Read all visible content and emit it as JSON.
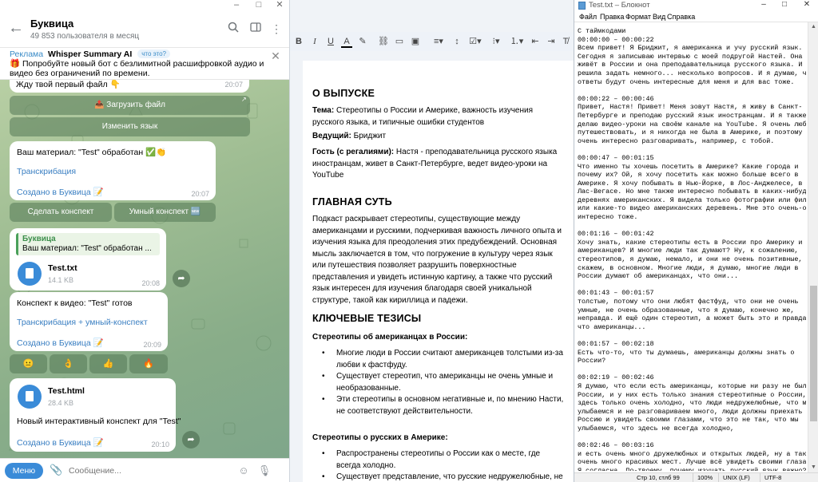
{
  "telegram": {
    "window_controls": [
      "–",
      "□",
      "✕"
    ],
    "header": {
      "title": "Буквица",
      "subtitle": "49 853 пользователя в месяц"
    },
    "ad": {
      "label": "Реклама",
      "title": "Whisper Summary AI",
      "badge": "что это?",
      "text": "🎁 Попробуйте новый бот с безлимитной расшифровкой аудио и видео без ограничений по времени."
    },
    "partial_message": {
      "text": "Жду твой первый файл 👇",
      "time": "20:07"
    },
    "buttons": {
      "upload": "📤 Загрузить файл",
      "change_lang": "Изменить язык"
    },
    "msg_processed": {
      "text": "Ваш материал: \"Test\" обработан ✅👏",
      "link1": "Транскрибация",
      "link2": "Создано в Буквица 📝",
      "time": "20:07"
    },
    "buttons2": {
      "summary": "Сделать конспект",
      "smart_summary": "Умный конспект 🆕"
    },
    "msg_file1": {
      "reply_author": "Буквица",
      "reply_text": "Ваш материал: \"Test\" обработан ...",
      "file_name": "Test.txt",
      "file_size": "14.1 KB",
      "time": "20:08"
    },
    "msg_summary_ready": {
      "text": "Конспект к видео: \"Test\" готов",
      "link1": "Транскрибация + умный-конспект",
      "link2": "Создано в Буквица 📝",
      "time": "20:09"
    },
    "reactions": [
      "😐",
      "👌",
      "👍",
      "🔥"
    ],
    "msg_file2": {
      "file_name": "Test.html",
      "file_size": "28.4 KB",
      "text": "Новый интерактивный конспект для \"Test\"",
      "link": "Создано в Буквица 📝",
      "time": "20:10"
    },
    "input": {
      "menu_label": "Меню",
      "placeholder": "Сообщение..."
    }
  },
  "doc": {
    "section1_title": "О ВЫПУСКЕ",
    "topic_label": "Тема:",
    "topic_text": " Стереотипы о России и Америке, важность изучения русского языка, и типичные ошибки студентов",
    "host_label": "Ведущий:",
    "host_text": " Бриджит",
    "guest_label": "Гость (с регалиями):",
    "guest_text": " Настя - преподавательница русского языка иностранцам, живет в Санкт-Петербурге, ведет видео-уроки на YouTube",
    "section2_title": "ГЛАВНАЯ СУТЬ",
    "main_text": "Подкаст раскрывает стереотипы, существующие между американцами и русскими, подчеркивая важность личного опыта и изучения языка для преодоления этих предубеждений. Основная мысль заключается в том, что погружение в культуру через язык или путешествия позволяет разрушить поверхностные представления и увидеть истинную картину, а также что русский язык интересен для изучения благодаря своей уникальной структуре, такой как кириллица и падежи.",
    "section3_title": "КЛЮЧЕВЫЕ ТЕЗИСЫ",
    "sub1_title": "Стереотипы об американцах в России:",
    "sub1_bullets": [
      "Многие люди в России считают американцев толстыми из-за любви к фастфуду.",
      "Существует стереотип, что американцы не очень умные и необразованные.",
      "Эти стереотипы в основном негативные и, по мнению Насти, не соответствуют действительности."
    ],
    "sub2_title": "Стереотипы о русских в Америке:",
    "sub2_bullets": [
      "Распространены стереотипы о России как о месте, где всегда холодно.",
      "Существует представление, что русские недружелюбные, не"
    ]
  },
  "notepad": {
    "title": "Test.txt – Блокнот",
    "menu": [
      "Файл",
      "Правка",
      "Формат",
      "Вид",
      "Справка"
    ],
    "content": "С таймкодами\n00:00:00 – 00:00:22\nВсем привет! Я Бриджит, я американка и учу русский язык.\nСегодня я записываю интервью с моей подругой Настей. Она\nживёт в России и она преподавательница русского языка. И я\nрешила задать немного... несколько вопросов. И я думаю, что\nответы будут очень интересные для меня и для вас тоже.\n\n00:00:22 – 00:00:46\nПривет, Настя! Привет! Меня зовут Настя, я живу в Санкт-\nПетербурге и преподаю русский язык иностранцам. И я также\nделаю видео-уроки на своём канале на YouTube. Я очень люблю\nпутешествовать, и я никогда не была в Америке, и поэтому мне\nочень интересно разговаривать, например, с тобой.\n\n00:00:47 – 00:01:15\nЧто именно ты хочешь посетить в Америке? Какие города и\nпочему их? Ой, я хочу посетить как можно больше всего в\nАмерике. Я хочу побывать в Нью-Йорке, в Лос-Анджелесе, в\nЛас-Вегасе. Но мне также интересно побывать в каких-нибудь\nдеревнях американских. Я видела только фотографии или фильмы\nили какие-то видео американских деревень. Мне это очень-очень\nинтересно тоже.\n\n00:01:16 – 00:01:42\nХочу знать, какие стереотипы есть в России про Америку и\nамериканцев? И многие люди так думают? Ну, к сожалению,\nстереотипов, я думаю, немало, и они не очень позитивные, так\nскажем, в основном. Многие люди, я думаю, многие люди в\nРоссии думают об американцах, что они...\n\n00:01:43 – 00:01:57\nтолстые, потому что они любят фастфуд, что они не очень\nумные, не очень образованные, что я думаю, конечно же,\nнеправда. И ещё один стереотип, а может быть это и правда,\nчто американцы...\n\n00:01:57 – 00:02:18\nЕсть что-то, что ты думаешь, американцы должны знать о\nРоссии?\n\n00:02:19 – 00:02:46\nЯ думаю, что если есть американцы, которые ни разу не были в\nРоссии, и у них есть только знания стереотипные о России, что\nздесь только очень холодно, что люди недружелюбные, что мы не\nулыбаемся и не разговариваем много, люди должны приехать в\nРоссию и увидеть своими глазами, что это не так, что мы\nулыбаемся, что здесь не всегда холодно,\n\n00:02:46 – 00:03:16\nи есть очень много дружелюбных и открытых людей, ну а также\nочень много красивых мест. Лучше всё увидеть своими глазами.\nЯ согласна. По-твоему, почему изучать русский язык важно? Я",
    "status": {
      "position": "Стр 10, стлб 99",
      "zoom": "100%",
      "eol": "UNIX (LF)",
      "encoding": "UTF-8"
    }
  }
}
